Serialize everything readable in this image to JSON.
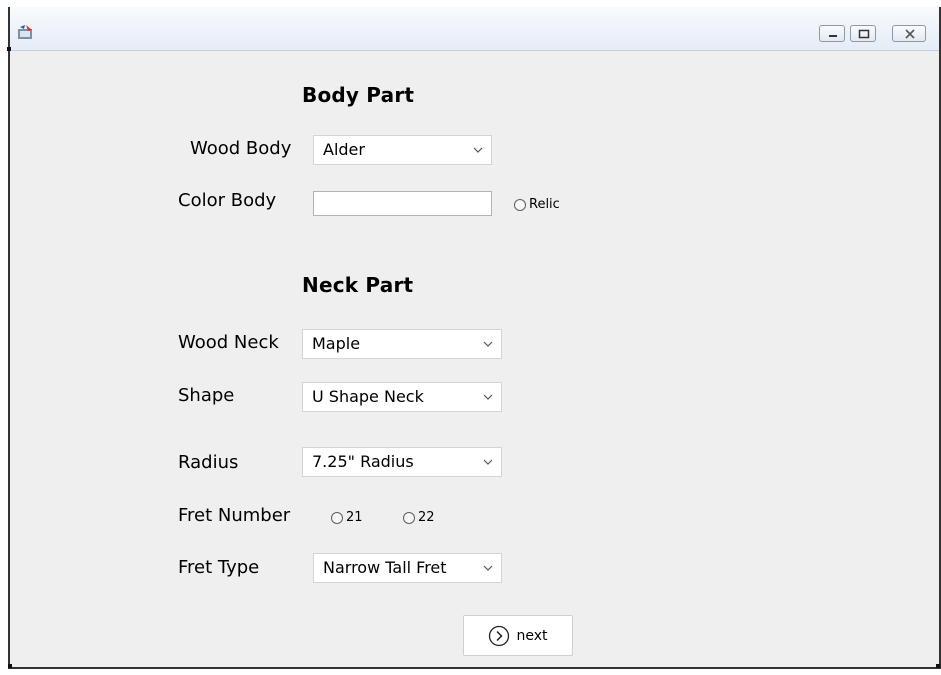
{
  "body_part": {
    "title": "Body Part",
    "wood_label": "Wood Body",
    "wood_value": "Alder",
    "color_label": "Color Body",
    "color_value": "",
    "relic_label": "Relic"
  },
  "neck_part": {
    "title": "Neck Part",
    "wood_label": "Wood Neck",
    "wood_value": "Maple",
    "shape_label": "Shape",
    "shape_value": "U Shape Neck",
    "radius_label": "Radius",
    "radius_value": "7.25\" Radius",
    "fret_number_label": "Fret Number",
    "fret_options": [
      "21",
      "22"
    ],
    "fret_type_label": "Fret Type",
    "fret_type_value": "Narrow Tall Fret"
  },
  "actions": {
    "next_label": "next"
  }
}
